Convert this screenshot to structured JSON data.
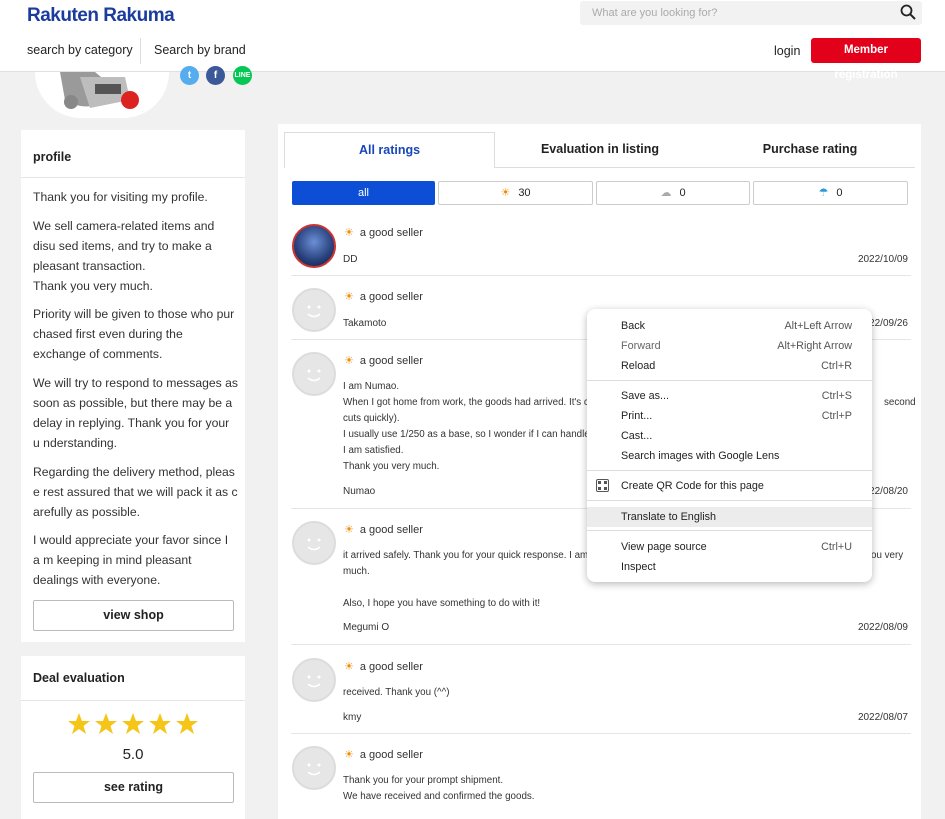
{
  "header": {
    "logo": "Rakuten Rakuma",
    "search_placeholder": "What are you looking for?",
    "nav_category": "search by category",
    "nav_brand": "Search by brand",
    "login": "login",
    "member_registration": "Member registration"
  },
  "profile": {
    "title": "profile",
    "pr_paragraphs": [
      "Thank you for visiting my profile.",
      "We sell camera-related items and disu sed items, and try to make a pleasant transaction.\nThank you very much.",
      "Priority will be given to those who pur chased first even during the exchange of comments.",
      "We will try to respond to messages as soon as possible, but there may be a delay in replying. Thank you for your u nderstanding.",
      "Regarding the delivery method, pleas e rest assured that we will pack it as c arefully as possible.",
      "I would appreciate your favor since I a m keeping in mind pleasant dealings with everyone."
    ],
    "view_shop": "view shop"
  },
  "deal": {
    "title": "Deal evaluation",
    "stars": 5,
    "score": "5.0",
    "see_rating": "see rating"
  },
  "tabs": [
    "All ratings",
    "Evaluation in listing",
    "Purchase rating"
  ],
  "filters": {
    "all": "all",
    "good_count": "30",
    "normal_count": "0",
    "bad_count": "0"
  },
  "reviews": [
    {
      "rating": "a good seller",
      "lines": [],
      "name": "DD",
      "date": "2022/10/09"
    },
    {
      "rating": "a good seller",
      "lines": [],
      "name": "Takamoto",
      "date": "2022/09/26"
    },
    {
      "rating": "a good seller",
      "lines": [
        "I am Numao.",
        "When I got home from work, the goods had arrived. It's cer",
        "cuts quickly).",
        "I usually use 1/250 as a base, so I wonder if I can handle th",
        "I am satisfied.",
        "Thank you very much."
      ],
      "extra": "second",
      "name": "Numao",
      "date": "2022/08/20"
    },
    {
      "rating": "a good seller",
      "lines": [
        "it arrived safely. Thank you for your quick response. I am h",
        "much.",
        "",
        "Also, I hope you have something to do with it!"
      ],
      "extra": "ou very",
      "name": "Megumi O",
      "date": "2022/08/09"
    },
    {
      "rating": "a good seller",
      "lines": [
        "received. Thank you (^^)"
      ],
      "name": "kmy",
      "date": "2022/08/07"
    },
    {
      "rating": "a good seller",
      "lines": [
        "Thank you for your prompt shipment.",
        "We have received and confirmed the goods."
      ],
      "name": "",
      "date": ""
    }
  ],
  "context_menu": {
    "items": [
      {
        "label": "Back",
        "shortcut": "Alt+Left Arrow"
      },
      {
        "label": "Forward",
        "shortcut": "Alt+Right Arrow"
      },
      {
        "label": "Reload",
        "shortcut": "Ctrl+R"
      },
      {
        "label": "Save as...",
        "shortcut": "Ctrl+S"
      },
      {
        "label": "Print...",
        "shortcut": "Ctrl+P"
      },
      {
        "label": "Cast...",
        "shortcut": ""
      },
      {
        "label": "Search images with Google Lens",
        "shortcut": ""
      },
      {
        "label": "Create QR Code for this page",
        "shortcut": ""
      },
      {
        "label": "Translate to English",
        "shortcut": ""
      },
      {
        "label": "View page source",
        "shortcut": "Ctrl+U"
      },
      {
        "label": "Inspect",
        "shortcut": ""
      }
    ]
  },
  "colors": {
    "brand_blue": "#1b3c9e",
    "member_red": "#e2001a",
    "filter_blue": "#0c4fd6",
    "star": "#f5c518"
  }
}
